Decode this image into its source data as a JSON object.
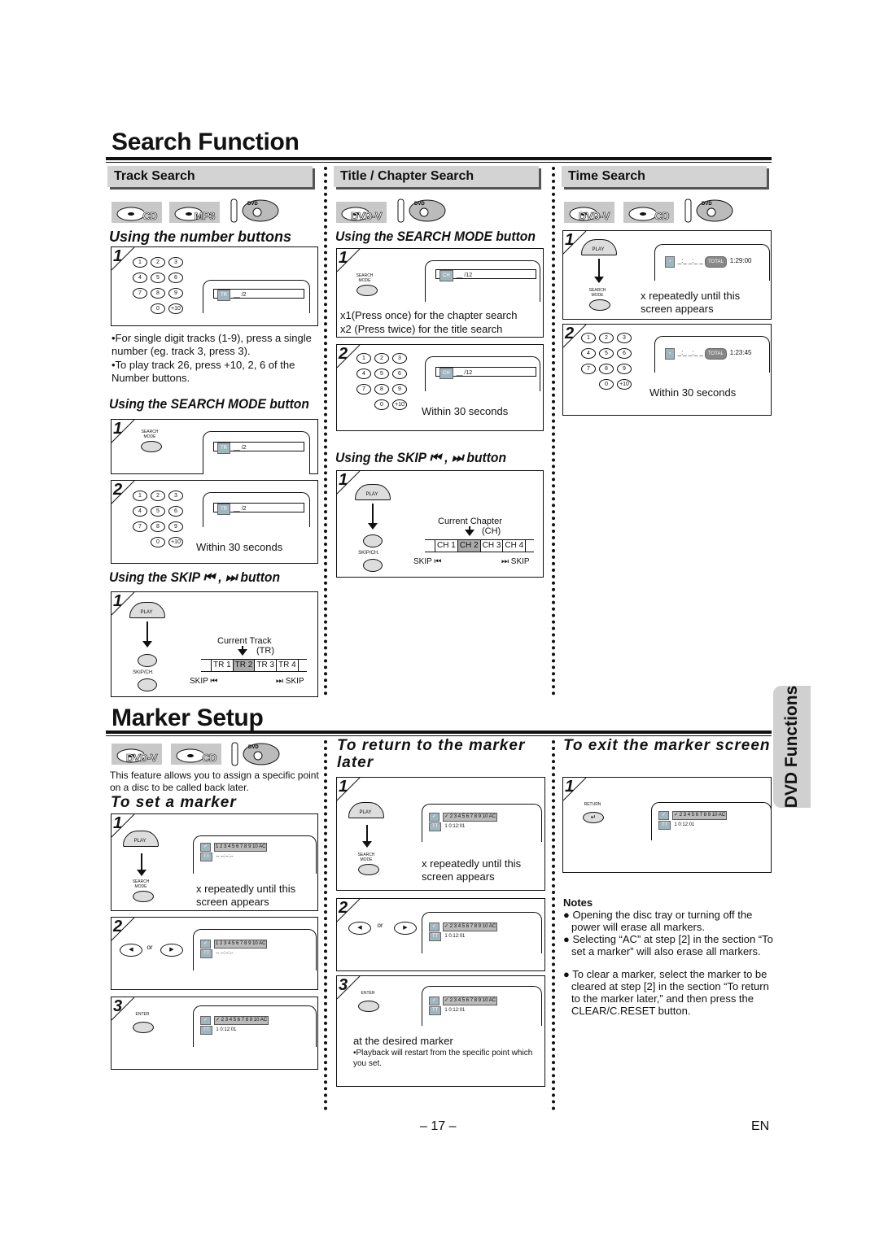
{
  "search_function": {
    "title": "Search Function",
    "track_search": {
      "header": "Track Search",
      "badges": [
        "CD",
        "MP3"
      ],
      "disc_logo": "DVD",
      "number_buttons": {
        "title": "Using the number buttons",
        "step1": {
          "num": "1",
          "display_chip": "TR",
          "display_value": "__ /2"
        },
        "notes": [
          "•For single digit tracks (1-9), press a single number (eg. track 3, press 3).",
          "•To play track 26, press +10, 2, 6 of the Number buttons."
        ]
      },
      "search_mode": {
        "title": "Using the SEARCH MODE button",
        "step1": {
          "num": "1",
          "button": "SEARCH MODE",
          "display_chip": "TR",
          "display_value": "__ /2"
        },
        "step2": {
          "num": "2",
          "display_chip": "TR",
          "display_value": "__ /2",
          "caption": "Within 30 seconds"
        }
      },
      "skip": {
        "title": "Using the SKIP ⏮ , ⏭ button",
        "step1": {
          "num": "1",
          "play_label": "PLAY",
          "skip_label": "SKIP/CH.",
          "current_label": "Current Track",
          "current_abbr": "(TR)",
          "cells": [
            "TR 1",
            "TR 2",
            "TR 3",
            "TR 4"
          ],
          "current_index": 1,
          "skip_back": "SKIP ⏮",
          "skip_fwd": "⏭ SKIP"
        }
      }
    },
    "title_chapter_search": {
      "header": "Title / Chapter Search",
      "badges": [
        "DVD-V"
      ],
      "disc_logo": "DVD",
      "search_mode": {
        "title": "Using the SEARCH MODE button",
        "step1": {
          "num": "1",
          "button": "SEARCH MODE",
          "display_chip": "CH",
          "display_value": "__ /12",
          "lines": [
            "x1(Press once) for the chapter search",
            "x2 (Press twice) for the title search"
          ]
        },
        "step2": {
          "num": "2",
          "display_chip": "CH",
          "display_value": "__ /12",
          "caption": "Within 30 seconds"
        }
      },
      "skip": {
        "title": "Using the SKIP ⏮ , ⏭ button",
        "step1": {
          "num": "1",
          "play_label": "PLAY",
          "skip_label": "SKIP/CH.",
          "current_label": "Current Chapter",
          "current_abbr": "(CH)",
          "cells": [
            "CH 1",
            "CH 2",
            "CH 3",
            "CH 4"
          ],
          "current_index": 1,
          "skip_back": "SKIP ⏮",
          "skip_fwd": "⏭ SKIP"
        }
      }
    },
    "time_search": {
      "header": "Time Search",
      "badges": [
        "DVD-V",
        "CD"
      ],
      "disc_logo": "DVD",
      "step1": {
        "num": "1",
        "play_label": "PLAY",
        "button": "SEARCH MODE",
        "display_time": "_:_ _:_ _",
        "total_label": "TOTAL",
        "total_value": "1:29:00",
        "caption": "x repeatedly until this screen appears"
      },
      "step2": {
        "num": "2",
        "display_time": "_:_ _:_ _",
        "total_label": "TOTAL",
        "total_value": "1:23:45",
        "caption": "Within 30 seconds"
      }
    }
  },
  "keypad": [
    "1",
    "2",
    "3",
    "4",
    "5",
    "6",
    "7",
    "8",
    "9",
    "0",
    "+10"
  ],
  "marker_setup": {
    "title": "Marker Setup",
    "badges": [
      "DVD-V",
      "CD"
    ],
    "disc_logo": "DVD",
    "intro": "This feature allows you to assign a specific point on a disc to be called back later.",
    "set_marker": {
      "title": "To set a marker",
      "step1": {
        "num": "1",
        "play_label": "PLAY",
        "button": "SEARCH MODE",
        "marks": "1 2 3 4 5 6 7 8 9 10 AC",
        "tt_value": "-- --:--:--",
        "caption": "x repeatedly until this screen appears"
      },
      "step2": {
        "num": "2",
        "or_label": "or",
        "marks": "1 2 3 4 5 6 7 8 9 10 AC",
        "tt_value": "-- --:--:--"
      },
      "step3": {
        "num": "3",
        "button": "ENTER",
        "marks": "✓ 2 3 4 5 6 7 8 9 10 AC",
        "tt_value": "1  0:12:01"
      }
    },
    "return_marker": {
      "title": "To return to the marker later",
      "step1": {
        "num": "1",
        "play_label": "PLAY",
        "button": "SEARCH MODE",
        "marks": "✓ 2 3 4 5 6 7 8 9 10 AC",
        "tt_value": "1  0:12:01",
        "caption": "x repeatedly until this screen appears"
      },
      "step2": {
        "num": "2",
        "or_label": "or",
        "marks": "✓ 2 3 4 5 6 7 8 9 10 AC",
        "tt_value": "1  0:12:01"
      },
      "step3": {
        "num": "3",
        "button": "ENTER",
        "marks": "✓ 2 3 4 5 6 7 8 9 10 AC",
        "tt_value": "1  0:12:01",
        "caption": "at the desired marker",
        "note": "•Playback will restart from the specific point which you set."
      }
    },
    "exit_marker": {
      "title": "To exit the marker screen",
      "step1": {
        "num": "1",
        "button": "RETURN",
        "marks": "✓ 2 3 4 5 6 7 8 9 10 AC",
        "tt_value": "1  0:12:01"
      }
    },
    "notes": {
      "title": "Notes",
      "items": [
        "● Opening the disc tray or turning off the power will erase all markers.",
        "● Selecting “AC” at step [2] in the section “To set a marker” will also erase all markers.",
        "● To clear a marker, select the marker to be cleared at step [2] in the section “To return to the marker later,”  and then press the CLEAR/C.RESET button."
      ]
    }
  },
  "side_tab": "DVD Functions",
  "footer": {
    "page_number": "– 17 –",
    "language": "EN"
  },
  "marker_chip_check": "✓",
  "marker_chip_tt": "TT"
}
